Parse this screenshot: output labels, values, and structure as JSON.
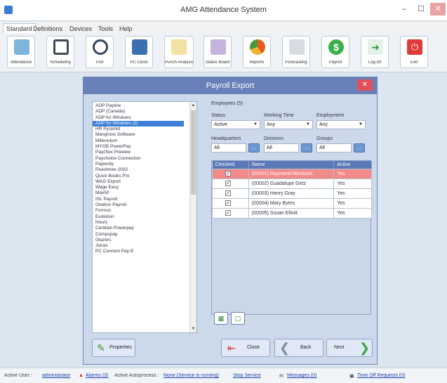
{
  "window": {
    "title": "AMG Attendance System",
    "minimize": "–",
    "maximize": "☐",
    "close": "✕"
  },
  "menu": [
    "Standard",
    "Definitions",
    "Devices",
    "Tools",
    "Help"
  ],
  "toolbar": [
    {
      "label": "Attendance",
      "icon": "attendance-icon",
      "color": "#7fb4dc"
    },
    {
      "label": "Scheduling",
      "icon": "calendar-icon",
      "color": "#3c4a5a"
    },
    {
      "label": "Poll",
      "icon": "clock-icon",
      "color": "#33485e"
    },
    {
      "label": "PC Clock",
      "icon": "pc-clock-icon",
      "color": "#3a6fb0"
    },
    {
      "label": "Punch Analysis",
      "icon": "punch-analysis-icon",
      "color": "#e7c24a"
    },
    {
      "label": "Status Board",
      "icon": "status-board-icon",
      "color": "#7e5aa8"
    },
    {
      "label": "Reports",
      "icon": "pie-chart-icon",
      "color": "#e85a1c"
    },
    {
      "label": "Forecasting",
      "icon": "forecasting-icon",
      "color": "#a0a7b4"
    },
    {
      "label": "Payroll",
      "icon": "payroll-icon",
      "color": "#3bb04a"
    },
    {
      "label": "Log off",
      "icon": "log-off-icon",
      "color": "#2f9a4a"
    },
    {
      "label": "Exit",
      "icon": "power-icon",
      "color": "#e03a3a"
    }
  ],
  "dialog": {
    "title": "Payroll Export",
    "close": "✕",
    "providers": [
      "ADP Payline",
      "ADP (Canada)",
      "ADP for Windows",
      "ADP for Windows (2)",
      "HR Pyramid",
      "Mangrove Software",
      "Millennium",
      "MYOB PowerPay",
      "Paychex Preview",
      "Paychoice Connection",
      "Paylocity",
      "Peachtree 2003",
      "Quick Books Pro",
      "WAG Export",
      "Wage Easy",
      "Max50",
      "ISL Payroll",
      "Ovation Payroll",
      "Ferrous",
      "Evolution",
      "Hours",
      "Ceridian Powerpay",
      "Compupay",
      "Glazers",
      "Jonas",
      "PC Connect Pay-E"
    ],
    "selected_provider": "ADP for Windows (2)",
    "employees_label": "Employees (5)",
    "status": {
      "label": "Status",
      "value": "Active"
    },
    "working_time": {
      "label": "Working Time",
      "value": "Any"
    },
    "employment": {
      "label": "Employment",
      "value": "Any"
    },
    "headquarters": {
      "label": "Headquarters",
      "value": "All",
      "button": "..."
    },
    "divisions": {
      "label": "Divisions",
      "value": "All",
      "button": "..."
    },
    "groups": {
      "label": "Groups",
      "value": "All",
      "button": "..."
    },
    "columns": [
      "Checked",
      "Name",
      "Active"
    ],
    "employees": [
      {
        "checked": true,
        "name": "(00001) Raymond McIntosh",
        "active": "Yes",
        "highlight": true
      },
      {
        "checked": true,
        "name": "(00002) Guadalupe Getz",
        "active": "Yes",
        "highlight": false
      },
      {
        "checked": true,
        "name": "(00003) Henry Gray",
        "active": "Yes",
        "highlight": false
      },
      {
        "checked": true,
        "name": "(00004) Mary Byers",
        "active": "Yes",
        "highlight": false
      },
      {
        "checked": true,
        "name": "(00005) Susan Elliott",
        "active": "Yes",
        "highlight": false
      }
    ],
    "buttons": {
      "properties": "Properties",
      "close": "Close",
      "back": "Back",
      "next": "Next"
    }
  },
  "status": {
    "active_user_label": "Active User :",
    "active_user": "administrator",
    "alarms": "Alarms (3)",
    "autoprocess_label": "Active Autoprocess :",
    "autoprocess": "None (Service is running)",
    "stop_service": "Stop Service",
    "messages": "Messages (0)",
    "time_off": "Time Off Requests (0)"
  }
}
